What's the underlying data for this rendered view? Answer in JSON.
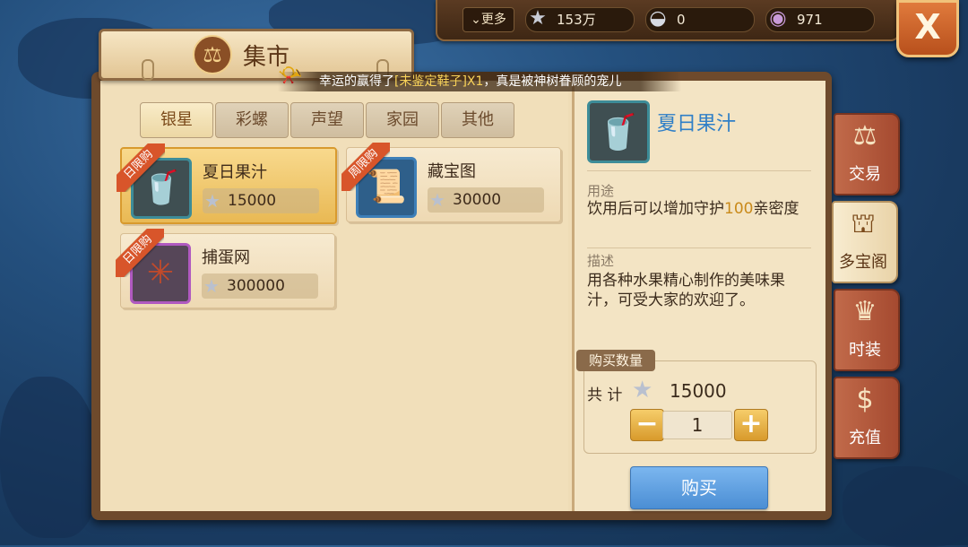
{
  "topbar": {
    "more_label": "更多",
    "currencies": [
      {
        "icon": "star-icon",
        "value": "153万"
      },
      {
        "icon": "shell-icon",
        "value": "0"
      },
      {
        "icon": "conch-icon",
        "value": "971"
      }
    ]
  },
  "title": "集市",
  "announcement": {
    "prefix": "幸运的赢得了",
    "item": "[未鉴定鞋子]X1",
    "suffix": "，真是被神树眷顾的宠儿"
  },
  "tabs": [
    "银星",
    "彩螺",
    "声望",
    "家园",
    "其他"
  ],
  "active_tab": 0,
  "items": [
    {
      "name": "夏日果汁",
      "price": "15000",
      "ribbon": "日限购",
      "selected": true
    },
    {
      "name": "藏宝图",
      "price": "30000",
      "ribbon": "周限购",
      "selected": false
    },
    {
      "name": "捕蛋网",
      "price": "300000",
      "ribbon": "日限购",
      "selected": false
    }
  ],
  "detail": {
    "name": "夏日果汁",
    "usage_label": "用途",
    "usage_pre": "饮用后可以增加守护",
    "usage_hl": "100",
    "usage_post": "亲密度",
    "desc_label": "描述",
    "desc_text": "用各种水果精心制作的美味果汁，可受大家的欢迎了。",
    "qty_label": "购买数量",
    "total_label": "共 计",
    "total_value": "15000",
    "qty_value": "1",
    "minus": "−",
    "plus": "+",
    "buy_label": "购买"
  },
  "side_tabs": [
    {
      "label": "交易",
      "icon": "scale-icon"
    },
    {
      "label": "多宝阁",
      "icon": "treasure-chest-icon",
      "active": true
    },
    {
      "label": "时装",
      "icon": "jacket-icon"
    },
    {
      "label": "充值",
      "icon": "dollar-icon"
    }
  ],
  "colors": {
    "accent_blue": "#2f7fc7",
    "ribbon_red": "#d8552a",
    "buy_blue": "#4b8ed4",
    "highlight_orange": "#c98a1a"
  }
}
